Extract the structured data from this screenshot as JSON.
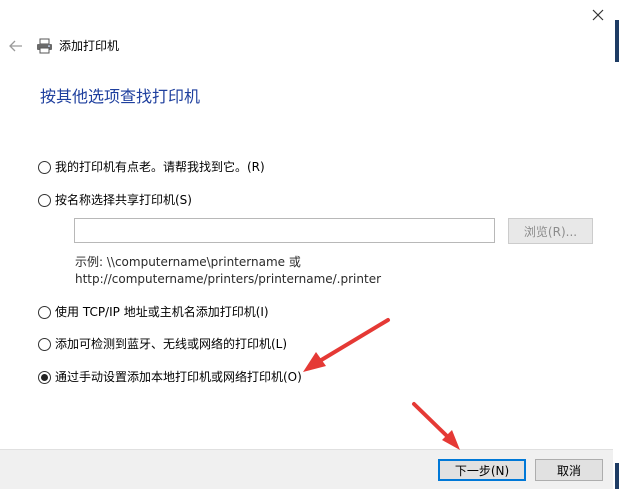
{
  "window": {
    "title": "添加打印机",
    "close_icon": "close-icon",
    "back_icon": "back-arrow-icon",
    "title_icon": "printer-icon"
  },
  "heading": "按其他选项查找打印机",
  "options": [
    {
      "label": "我的打印机有点老。请帮我找到它。(R)",
      "checked": false
    },
    {
      "label": "按名称选择共享打印机(S)",
      "checked": false
    },
    {
      "label": "使用 TCP/IP 地址或主机名添加打印机(I)",
      "checked": false
    },
    {
      "label": "添加可检测到蓝牙、无线或网络的打印机(L)",
      "checked": false
    },
    {
      "label": "通过手动设置添加本地打印机或网络打印机(O)",
      "checked": true
    }
  ],
  "share": {
    "input_value": "",
    "browse_label": "浏览(R)...",
    "example_line1": "示例: \\\\computername\\printername 或",
    "example_line2": "http://computername/printers/printername/.printer"
  },
  "buttons": {
    "next": "下一步(N)",
    "cancel": "取消"
  },
  "colors": {
    "heading": "#1e3f9e",
    "annotation_arrow": "#e53935",
    "default_button_border": "#0078d7"
  }
}
